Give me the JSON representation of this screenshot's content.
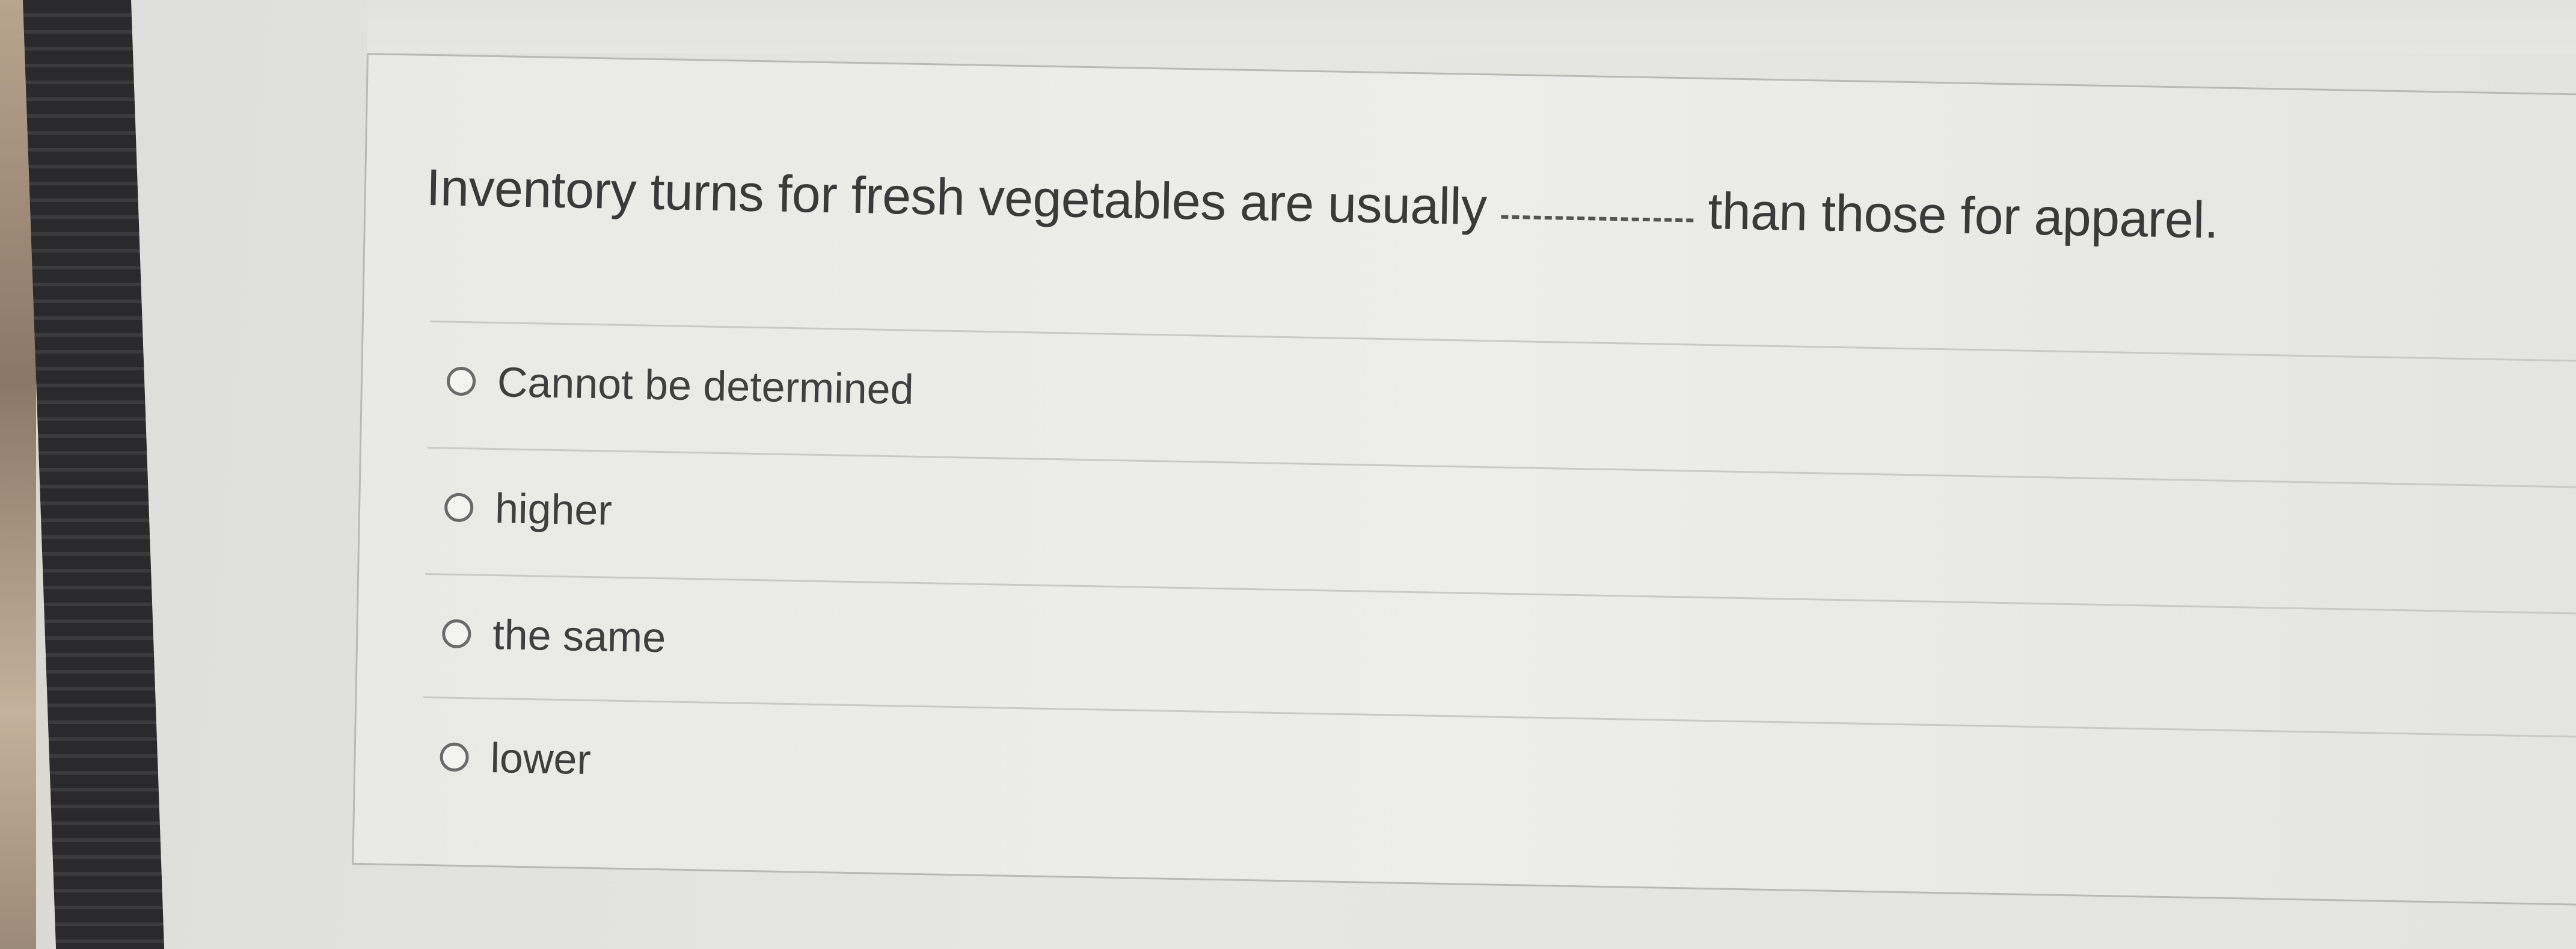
{
  "question": {
    "text_before": "Inventory turns for fresh vegetables are usually",
    "text_after": "than those for apparel."
  },
  "options": [
    {
      "label": "Cannot be determined",
      "selected": false
    },
    {
      "label": "higher",
      "selected": false
    },
    {
      "label": "the same",
      "selected": false
    },
    {
      "label": "lower",
      "selected": false
    }
  ]
}
